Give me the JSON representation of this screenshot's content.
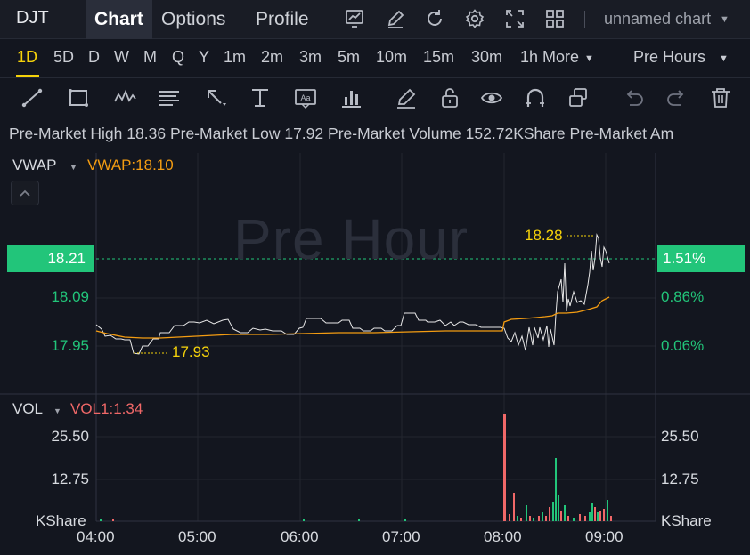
{
  "header": {
    "ticker": "DJT",
    "tabs": [
      {
        "label": "Chart",
        "active": true
      },
      {
        "label": "Options",
        "active": false
      },
      {
        "label": "Profile",
        "active": false
      }
    ],
    "icons": [
      "chart-settings-icon",
      "draw-icon",
      "refresh-icon",
      "gear-icon",
      "fullscreen-icon",
      "layout-grid-icon"
    ],
    "layout_name": "unnamed chart"
  },
  "timeframes": {
    "items": [
      "1D",
      "5D",
      "D",
      "W",
      "M",
      "Q",
      "Y",
      "1m",
      "2m",
      "3m",
      "5m",
      "10m",
      "15m",
      "30m",
      "1h"
    ],
    "active": "1D",
    "more_label": "More",
    "session_label": "Pre Hours"
  },
  "drawing_tools": [
    "trend-line-icon",
    "rectangle-icon",
    "pattern-icon",
    "fib-icon",
    "arrow-icon",
    "price-range-icon",
    "text-icon",
    "bar-pattern-icon",
    "brush-icon",
    "lock-icon",
    "eye-icon",
    "magnet-icon",
    "layers-icon",
    "undo-icon",
    "redo-icon",
    "trash-icon"
  ],
  "premarket": {
    "high_label": "Pre-Market High",
    "high": "18.36",
    "low_label": "Pre-Market Low",
    "low": "17.92",
    "volume_label": "Pre-Market Volume",
    "volume": "152.72KShare",
    "amount_label": "Pre-Market Am"
  },
  "price_pane": {
    "indicator": "VWAP",
    "indicator_value": "VWAP:18.10",
    "watermark": "Pre Hour",
    "current_price": "18.21",
    "current_pct": "1.51%",
    "y_labels": [
      "18.09",
      "17.95"
    ],
    "y_pct_labels": [
      "0.86%",
      "0.06%"
    ],
    "high_marker": "18.28",
    "low_marker": "17.93",
    "colors": {
      "price_line": "#e8e8e8",
      "vwap_line": "#f39c12",
      "up": "#22c57a",
      "down": "#f06868",
      "accent": "#f5d20a"
    }
  },
  "volume_pane": {
    "indicator": "VOL",
    "indicator_value": "VOL1:1.34",
    "y_labels": [
      "25.50",
      "12.75"
    ],
    "unit": "KShare"
  },
  "x_axis": [
    "04:00",
    "05:00",
    "06:00",
    "07:00",
    "08:00",
    "09:00"
  ]
}
